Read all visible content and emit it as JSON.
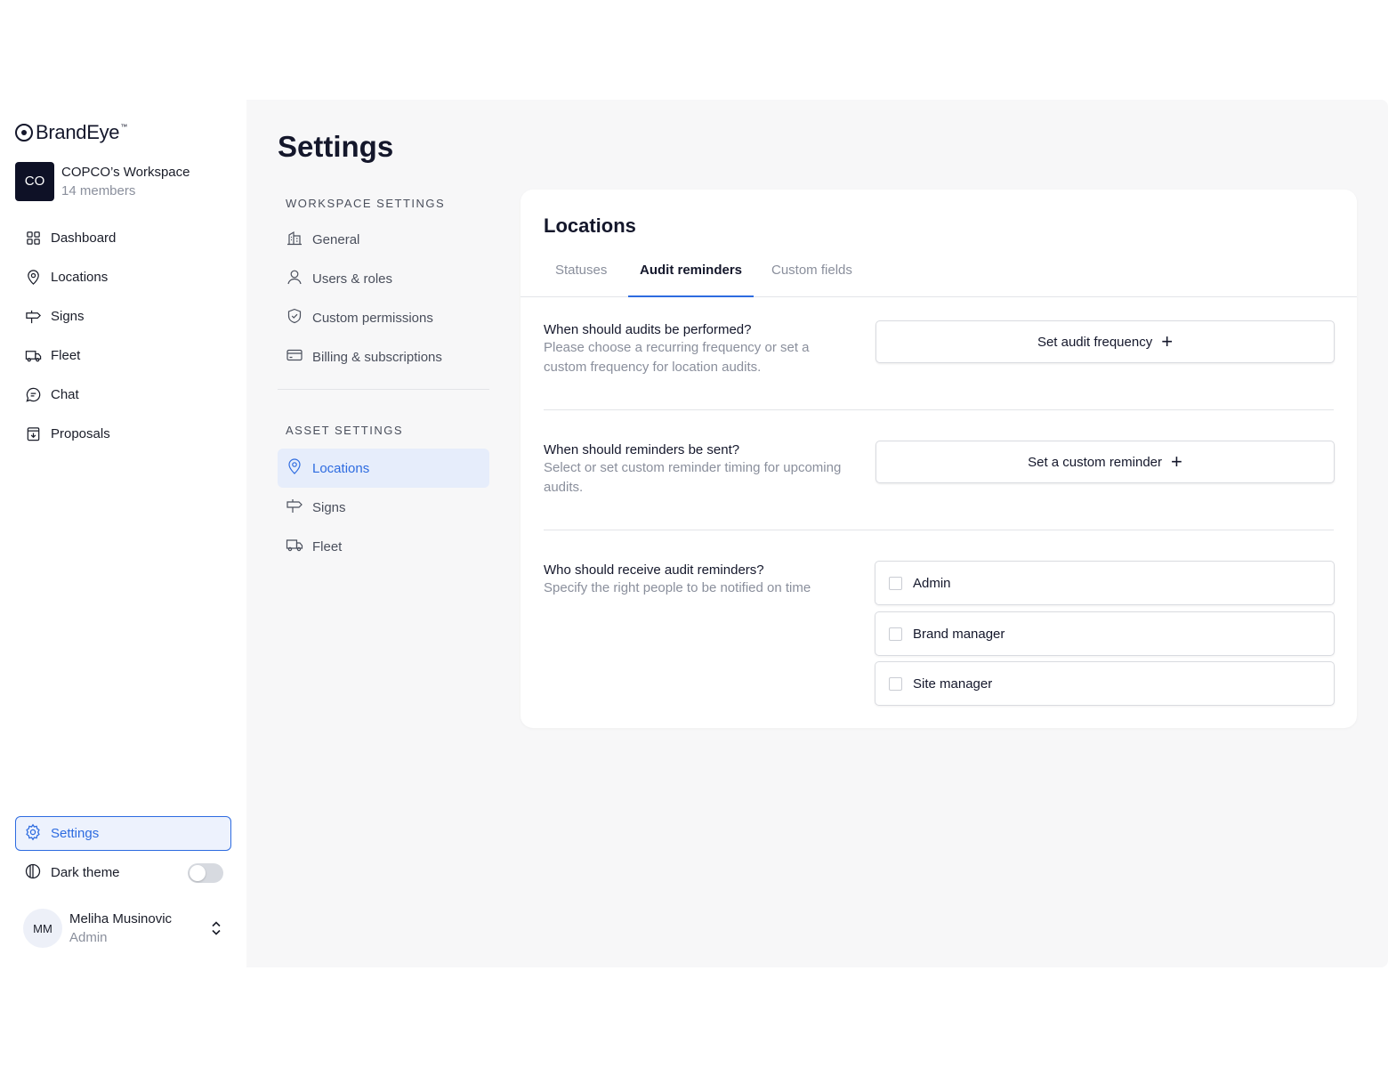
{
  "brand": {
    "name": "BrandEye",
    "tm": "™"
  },
  "workspace": {
    "initials": "CO",
    "name": "COPCO’s Workspace",
    "members": "14 members"
  },
  "nav": [
    {
      "label": "Dashboard",
      "icon": "dashboard-icon"
    },
    {
      "label": "Locations",
      "icon": "location-pin-icon"
    },
    {
      "label": "Signs",
      "icon": "signpost-icon"
    },
    {
      "label": "Fleet",
      "icon": "truck-icon"
    },
    {
      "label": "Chat",
      "icon": "chat-icon"
    },
    {
      "label": "Proposals",
      "icon": "proposal-icon"
    }
  ],
  "sidebar_bottom": {
    "settings_label": "Settings",
    "dark_theme_label": "Dark theme",
    "dark_theme_on": false
  },
  "user": {
    "initials": "MM",
    "name": "Meliha Musinovic",
    "role": "Admin"
  },
  "page": {
    "title": "Settings"
  },
  "sub_nav": {
    "workspace_label": "WORKSPACE SETTINGS",
    "workspace_items": [
      {
        "label": "General",
        "icon": "building-icon"
      },
      {
        "label": "Users & roles",
        "icon": "user-icon"
      },
      {
        "label": "Custom permissions",
        "icon": "shield-icon"
      },
      {
        "label": "Billing & subscriptions",
        "icon": "credit-card-icon"
      }
    ],
    "asset_label": "ASSET SETTINGS",
    "asset_items": [
      {
        "label": "Locations",
        "icon": "location-pin-icon",
        "active": true
      },
      {
        "label": "Signs",
        "icon": "signpost-icon"
      },
      {
        "label": "Fleet",
        "icon": "truck-icon"
      }
    ]
  },
  "card": {
    "title": "Locations",
    "tabs": [
      {
        "label": "Statuses"
      },
      {
        "label": "Audit reminders",
        "active": true
      },
      {
        "label": "Custom fields"
      }
    ],
    "sections": [
      {
        "question": "When should audits be performed?",
        "description": "Please choose a recurring frequency or set a custom frequency for location audits.",
        "button": "Set audit frequency"
      },
      {
        "question": "When should reminders be sent?",
        "description": "Select or set custom reminder timing for upcoming audits.",
        "button": "Set a custom reminder"
      },
      {
        "question": "Who should receive audit reminders?",
        "description": "Specify the right people to be notified on time",
        "options": [
          "Admin",
          "Brand manager",
          "Site manager"
        ]
      }
    ]
  },
  "colors": {
    "accent": "#2d6be0",
    "dark": "#0e1126",
    "main_bg": "#f7f7f8"
  }
}
